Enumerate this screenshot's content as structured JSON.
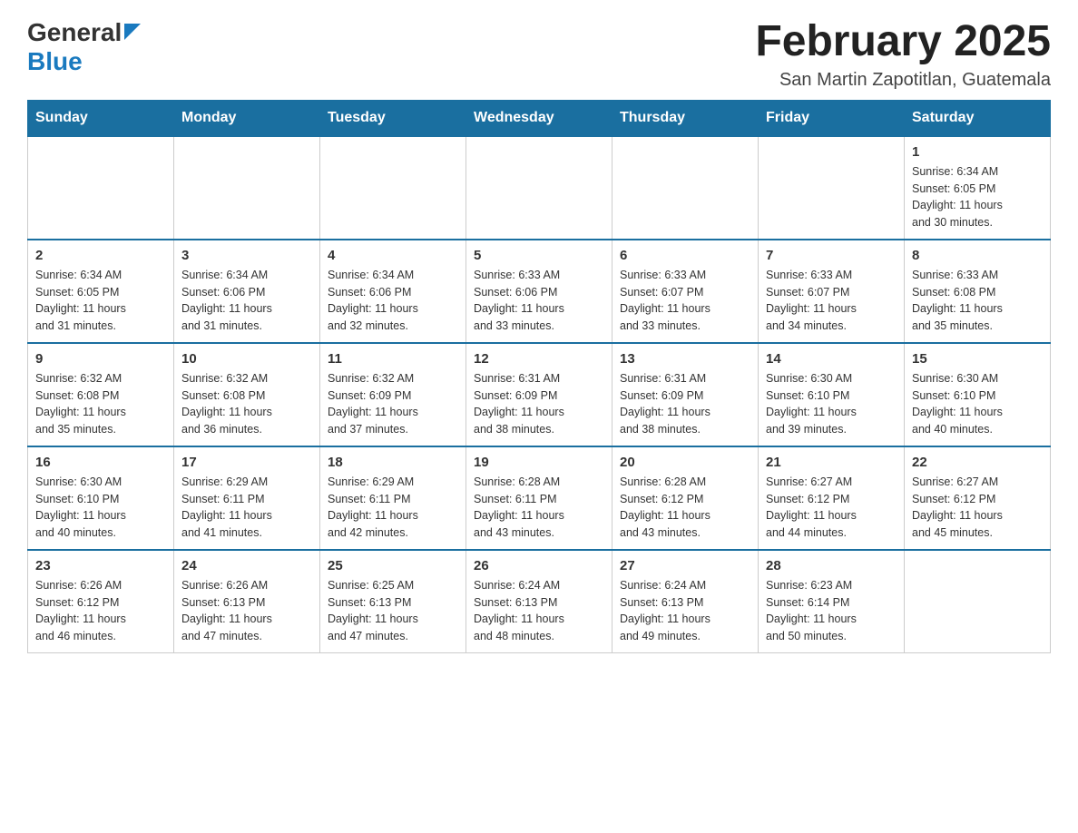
{
  "header": {
    "logo_line1": "General",
    "logo_line2": "Blue",
    "title": "February 2025",
    "subtitle": "San Martin Zapotitlan, Guatemala"
  },
  "days_of_week": [
    "Sunday",
    "Monday",
    "Tuesday",
    "Wednesday",
    "Thursday",
    "Friday",
    "Saturday"
  ],
  "weeks": [
    [
      {
        "day": "",
        "info": ""
      },
      {
        "day": "",
        "info": ""
      },
      {
        "day": "",
        "info": ""
      },
      {
        "day": "",
        "info": ""
      },
      {
        "day": "",
        "info": ""
      },
      {
        "day": "",
        "info": ""
      },
      {
        "day": "1",
        "info": "Sunrise: 6:34 AM\nSunset: 6:05 PM\nDaylight: 11 hours\nand 30 minutes."
      }
    ],
    [
      {
        "day": "2",
        "info": "Sunrise: 6:34 AM\nSunset: 6:05 PM\nDaylight: 11 hours\nand 31 minutes."
      },
      {
        "day": "3",
        "info": "Sunrise: 6:34 AM\nSunset: 6:06 PM\nDaylight: 11 hours\nand 31 minutes."
      },
      {
        "day": "4",
        "info": "Sunrise: 6:34 AM\nSunset: 6:06 PM\nDaylight: 11 hours\nand 32 minutes."
      },
      {
        "day": "5",
        "info": "Sunrise: 6:33 AM\nSunset: 6:06 PM\nDaylight: 11 hours\nand 33 minutes."
      },
      {
        "day": "6",
        "info": "Sunrise: 6:33 AM\nSunset: 6:07 PM\nDaylight: 11 hours\nand 33 minutes."
      },
      {
        "day": "7",
        "info": "Sunrise: 6:33 AM\nSunset: 6:07 PM\nDaylight: 11 hours\nand 34 minutes."
      },
      {
        "day": "8",
        "info": "Sunrise: 6:33 AM\nSunset: 6:08 PM\nDaylight: 11 hours\nand 35 minutes."
      }
    ],
    [
      {
        "day": "9",
        "info": "Sunrise: 6:32 AM\nSunset: 6:08 PM\nDaylight: 11 hours\nand 35 minutes."
      },
      {
        "day": "10",
        "info": "Sunrise: 6:32 AM\nSunset: 6:08 PM\nDaylight: 11 hours\nand 36 minutes."
      },
      {
        "day": "11",
        "info": "Sunrise: 6:32 AM\nSunset: 6:09 PM\nDaylight: 11 hours\nand 37 minutes."
      },
      {
        "day": "12",
        "info": "Sunrise: 6:31 AM\nSunset: 6:09 PM\nDaylight: 11 hours\nand 38 minutes."
      },
      {
        "day": "13",
        "info": "Sunrise: 6:31 AM\nSunset: 6:09 PM\nDaylight: 11 hours\nand 38 minutes."
      },
      {
        "day": "14",
        "info": "Sunrise: 6:30 AM\nSunset: 6:10 PM\nDaylight: 11 hours\nand 39 minutes."
      },
      {
        "day": "15",
        "info": "Sunrise: 6:30 AM\nSunset: 6:10 PM\nDaylight: 11 hours\nand 40 minutes."
      }
    ],
    [
      {
        "day": "16",
        "info": "Sunrise: 6:30 AM\nSunset: 6:10 PM\nDaylight: 11 hours\nand 40 minutes."
      },
      {
        "day": "17",
        "info": "Sunrise: 6:29 AM\nSunset: 6:11 PM\nDaylight: 11 hours\nand 41 minutes."
      },
      {
        "day": "18",
        "info": "Sunrise: 6:29 AM\nSunset: 6:11 PM\nDaylight: 11 hours\nand 42 minutes."
      },
      {
        "day": "19",
        "info": "Sunrise: 6:28 AM\nSunset: 6:11 PM\nDaylight: 11 hours\nand 43 minutes."
      },
      {
        "day": "20",
        "info": "Sunrise: 6:28 AM\nSunset: 6:12 PM\nDaylight: 11 hours\nand 43 minutes."
      },
      {
        "day": "21",
        "info": "Sunrise: 6:27 AM\nSunset: 6:12 PM\nDaylight: 11 hours\nand 44 minutes."
      },
      {
        "day": "22",
        "info": "Sunrise: 6:27 AM\nSunset: 6:12 PM\nDaylight: 11 hours\nand 45 minutes."
      }
    ],
    [
      {
        "day": "23",
        "info": "Sunrise: 6:26 AM\nSunset: 6:12 PM\nDaylight: 11 hours\nand 46 minutes."
      },
      {
        "day": "24",
        "info": "Sunrise: 6:26 AM\nSunset: 6:13 PM\nDaylight: 11 hours\nand 47 minutes."
      },
      {
        "day": "25",
        "info": "Sunrise: 6:25 AM\nSunset: 6:13 PM\nDaylight: 11 hours\nand 47 minutes."
      },
      {
        "day": "26",
        "info": "Sunrise: 6:24 AM\nSunset: 6:13 PM\nDaylight: 11 hours\nand 48 minutes."
      },
      {
        "day": "27",
        "info": "Sunrise: 6:24 AM\nSunset: 6:13 PM\nDaylight: 11 hours\nand 49 minutes."
      },
      {
        "day": "28",
        "info": "Sunrise: 6:23 AM\nSunset: 6:14 PM\nDaylight: 11 hours\nand 50 minutes."
      },
      {
        "day": "",
        "info": ""
      }
    ]
  ]
}
